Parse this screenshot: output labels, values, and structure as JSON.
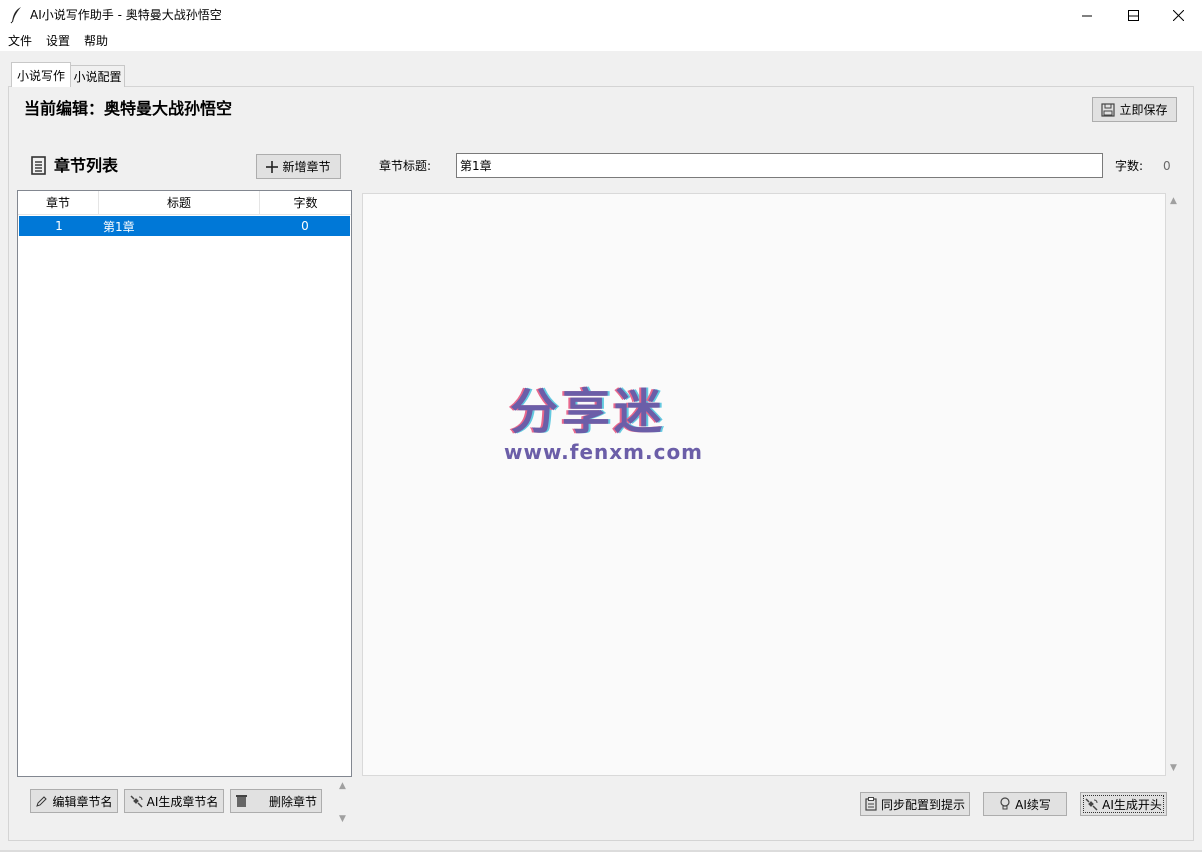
{
  "window": {
    "title": "AI小说写作助手 - 奥特曼大战孙悟空",
    "controls": [
      "minimize",
      "maximize",
      "close"
    ]
  },
  "menubar": {
    "items": [
      "文件",
      "设置",
      "帮助"
    ]
  },
  "tabs": [
    {
      "label": "小说写作",
      "active": true
    },
    {
      "label": "小说配置",
      "active": false
    }
  ],
  "header": {
    "current_edit": "当前编辑：奥特曼大战孙悟空",
    "save_label": "立即保存",
    "save_icon": "floppy-disk-icon"
  },
  "chapter_list": {
    "title": "章节列表",
    "title_icon": "document-list-icon",
    "add_label": "新增章节",
    "add_icon": "plus-icon",
    "columns": [
      "章节",
      "标题",
      "字数"
    ],
    "rows": [
      {
        "num": "1",
        "title": "第1章",
        "count": "0",
        "selected": true
      }
    ]
  },
  "editor": {
    "title_label": "章节标题:",
    "title_value": "第1章",
    "wordcount_label": "字数:",
    "wordcount_value": "0",
    "content": ""
  },
  "left_buttons": [
    {
      "label": "编辑章节名",
      "icon": "pencil-icon"
    },
    {
      "label": "AI生成章节名",
      "icon": "satellite-icon"
    },
    {
      "label": "删除章节",
      "icon": "trash-icon"
    }
  ],
  "right_buttons": [
    {
      "label": "同步配置到提示",
      "icon": "clipboard-icon"
    },
    {
      "label": "AI续写",
      "icon": "lightbulb-icon"
    },
    {
      "label": "AI生成开头",
      "icon": "satellite-icon"
    }
  ],
  "watermark": {
    "text": "分享迷",
    "url": "www.fenxm.com"
  },
  "colors": {
    "selection": "#0078d7",
    "button_bg": "#e1e1e1",
    "window_bg": "#f0f0f0"
  }
}
